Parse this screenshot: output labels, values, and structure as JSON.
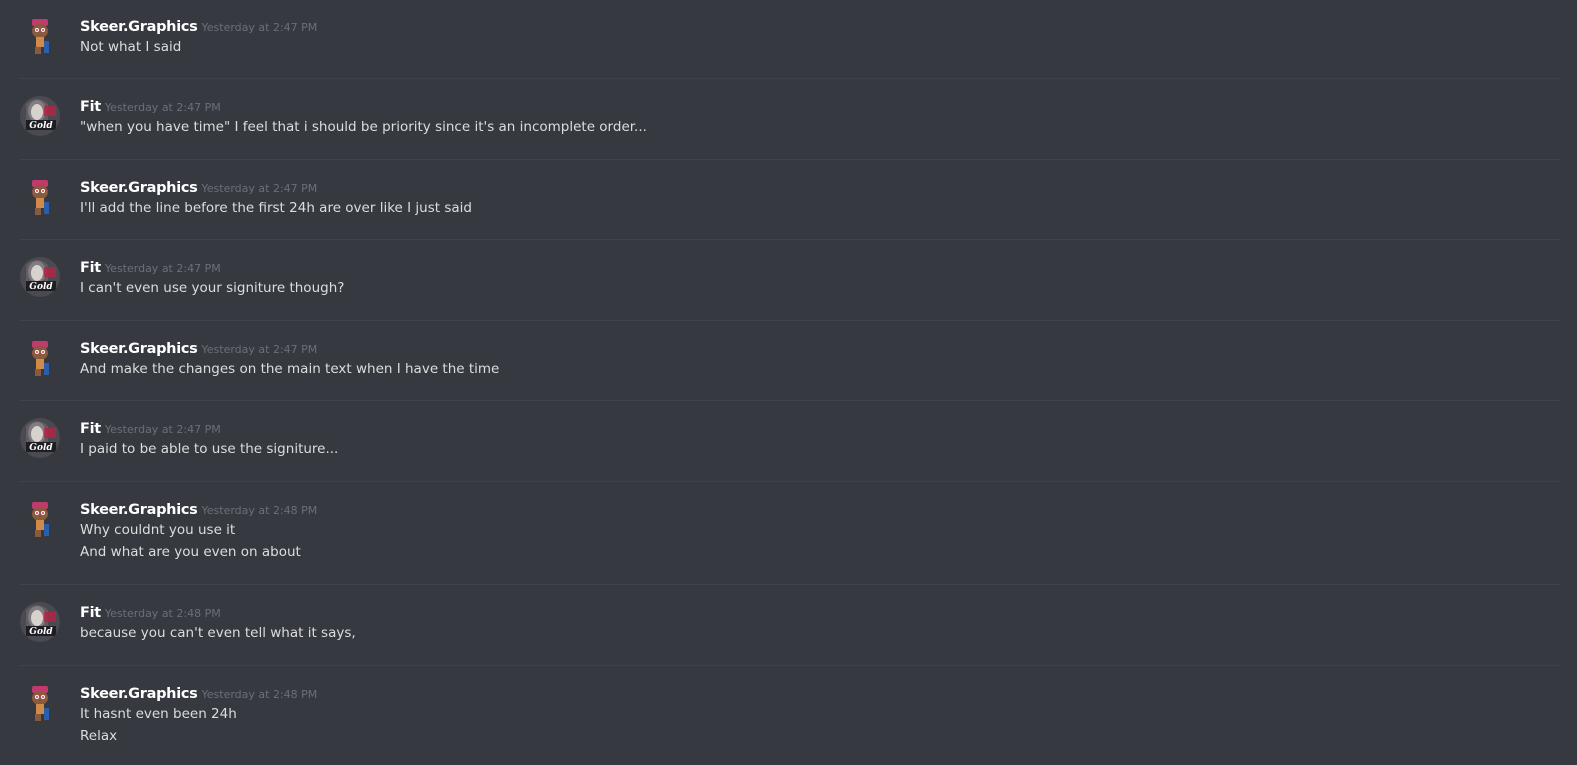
{
  "users": {
    "skeer": {
      "name": "Skeer.Graphics",
      "avatar_icon": "cartoon-character-avatar-icon"
    },
    "fit": {
      "name": "Fit",
      "avatar_icon": "portrait-gold-logo-avatar-icon"
    }
  },
  "messages": [
    {
      "author": "Skeer.Graphics",
      "timestamp": "Yesterday at 2:47 PM",
      "lines": [
        "Not what I said"
      ]
    },
    {
      "author": "Fit",
      "timestamp": "Yesterday at 2:47 PM",
      "lines": [
        "\"when you have time\" I feel that i should be priority since it's an incomplete order..."
      ]
    },
    {
      "author": "Skeer.Graphics",
      "timestamp": "Yesterday at 2:47 PM",
      "lines": [
        "I'll add the line before the first 24h are over like I just said"
      ]
    },
    {
      "author": "Fit",
      "timestamp": "Yesterday at 2:47 PM",
      "lines": [
        "I can't even use your signiture though?"
      ]
    },
    {
      "author": "Skeer.Graphics",
      "timestamp": "Yesterday at 2:47 PM",
      "lines": [
        "And make the changes on the main text when I have the time"
      ]
    },
    {
      "author": "Fit",
      "timestamp": "Yesterday at 2:47 PM",
      "lines": [
        "I paid to be able to use the signiture..."
      ]
    },
    {
      "author": "Skeer.Graphics",
      "timestamp": "Yesterday at 2:48 PM",
      "lines": [
        "Why couldnt you use it",
        "And what are you even on about"
      ]
    },
    {
      "author": "Fit",
      "timestamp": "Yesterday at 2:48 PM",
      "lines": [
        "because you can't even tell what it says,"
      ]
    },
    {
      "author": "Skeer.Graphics",
      "timestamp": "Yesterday at 2:48 PM",
      "lines": [
        "It hasnt even been 24h",
        "Relax"
      ]
    }
  ],
  "colors": {
    "background": "#36393f",
    "divider": "#3f4248",
    "username": "#ffffff",
    "timestamp": "#6b6f76",
    "message_text": "#dcddde"
  }
}
